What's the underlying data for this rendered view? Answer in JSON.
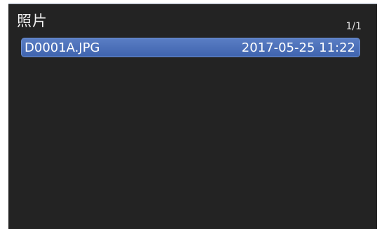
{
  "header": {
    "title": "照片",
    "page_indicator": "1/1"
  },
  "files": [
    {
      "name": "D0001A.JPG",
      "datetime": "2017-05-25 11:22",
      "selected": true
    }
  ],
  "colors": {
    "screen_background": "#232323",
    "selection_highlight": "#4a6fb8",
    "text": "#ffffff"
  }
}
